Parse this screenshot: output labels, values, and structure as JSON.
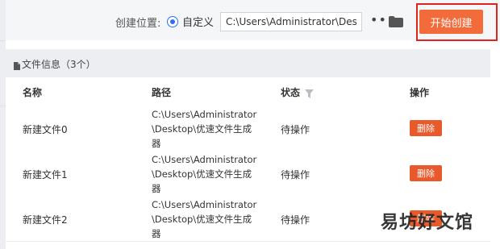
{
  "toolbar": {
    "location_label": "创建位置:",
    "radio_label": "自定义",
    "path_value": "C:\\Users\\Administrator\\Desktop",
    "more_icon": "more-dots-icon",
    "folder_icon": "folder-icon",
    "start_button": "开始创建"
  },
  "file_info": {
    "title": "文件信息（3个）"
  },
  "table": {
    "columns": [
      "名称",
      "路径",
      "状态",
      "操作"
    ],
    "rows": [
      {
        "name": "新建文件0",
        "path": "C:\\Users\\Administrator\\Desktop\\优速文件生成器",
        "status": "待操作",
        "action": "删除"
      },
      {
        "name": "新建文件1",
        "path": "C:\\Users\\Administrator\\Desktop\\优速文件生成器",
        "status": "待操作",
        "action": "删除"
      },
      {
        "name": "新建文件2",
        "path": "C:\\Users\\Administrator\\Desktop\\优速文件生成器",
        "status": "待操作",
        "action": "删除"
      }
    ]
  },
  "watermark": "易坊好文馆",
  "colors": {
    "accent": "#f26b3a",
    "delete": "#e85a2c",
    "highlight": "#e0231c",
    "radio": "#2f6fed"
  }
}
